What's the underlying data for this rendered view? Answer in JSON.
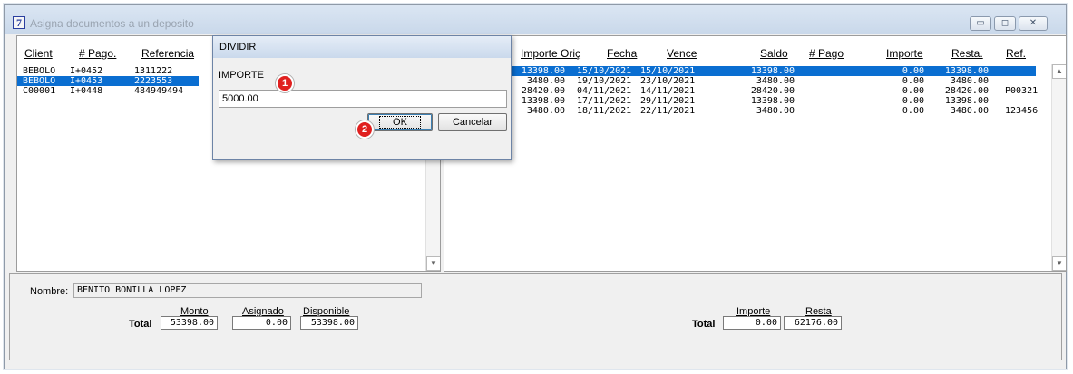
{
  "window": {
    "title": "Asigna documentos a un deposito",
    "icon_glyph": "7",
    "controls": {
      "minimize": "▭",
      "maximize": "◻",
      "close": "✕"
    }
  },
  "left_grid": {
    "columns": [
      "Client",
      "# Pago.",
      "Referencia"
    ],
    "rows": [
      {
        "client": "BEBOLO",
        "pago": "I+0452",
        "ref": "1311222",
        "selected": false
      },
      {
        "client": "BEBOLO",
        "pago": "I+0453",
        "ref": "2223553",
        "selected": true
      },
      {
        "client": "C00001",
        "pago": "I+0448",
        "ref": "484949494",
        "selected": false
      }
    ]
  },
  "right_grid": {
    "columns": [
      "Importe Oriç",
      "Fecha",
      "Vence",
      "Saldo",
      "# Pago",
      "Importe",
      "Resta.",
      "Ref."
    ],
    "rows": [
      {
        "importe_orig": "13398.00",
        "fecha": "15/10/2021",
        "vence": "15/10/2021",
        "saldo": "13398.00",
        "importe": "0.00",
        "resta": "13398.00",
        "ref": "",
        "selected": true
      },
      {
        "importe_orig": "3480.00",
        "fecha": "19/10/2021",
        "vence": "23/10/2021",
        "saldo": "3480.00",
        "importe": "0.00",
        "resta": "3480.00",
        "ref": "",
        "selected": false
      },
      {
        "importe_orig": "28420.00",
        "fecha": "04/11/2021",
        "vence": "14/11/2021",
        "saldo": "28420.00",
        "importe": "0.00",
        "resta": "28420.00",
        "ref": "P00321",
        "selected": false
      },
      {
        "importe_orig": "13398.00",
        "fecha": "17/11/2021",
        "vence": "29/11/2021",
        "saldo": "13398.00",
        "importe": "0.00",
        "resta": "13398.00",
        "ref": "",
        "selected": false
      },
      {
        "importe_orig": "3480.00",
        "fecha": "18/11/2021",
        "vence": "22/11/2021",
        "saldo": "3480.00",
        "importe": "0.00",
        "resta": "3480.00",
        "ref": "123456",
        "selected": false
      }
    ]
  },
  "bottom": {
    "nombre_label": "Nombre:",
    "nombre_value": "BENITO BONILLA LOPEZ",
    "left_totals": {
      "total_label": "Total",
      "monto_label": "Monto",
      "asignado_label": "Asignado",
      "disponible_label": "Disponible",
      "monto": "53398.00",
      "asignado": "0.00",
      "disponible": "53398.00"
    },
    "right_totals": {
      "total_label": "Total",
      "importe_label": "Importe",
      "resta_label": "Resta",
      "importe": "0.00",
      "resta": "62176.00"
    }
  },
  "dialog": {
    "title": "DIVIDIR",
    "label": "IMPORTE",
    "value": "5000.00",
    "ok_label": "OK",
    "cancel_label": "Cancelar"
  },
  "annotations": {
    "step1": "1",
    "step2": "2"
  },
  "colors": {
    "selection": "#0a6ed1",
    "badge": "#e0201f"
  }
}
